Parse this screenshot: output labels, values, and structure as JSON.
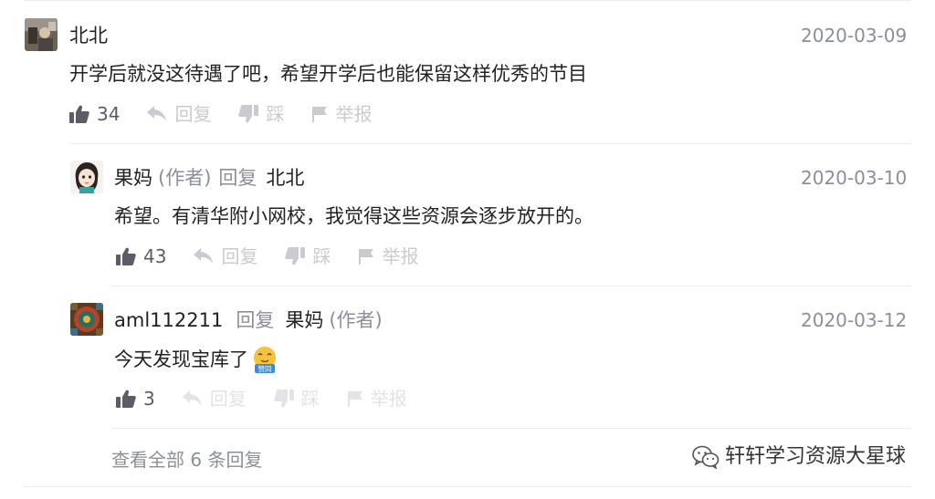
{
  "comments": [
    {
      "author": "北北",
      "date": "2020-03-09",
      "text": "开学后就没这待遇了吧，希望开学后也能保留这样优秀的节目",
      "likes": "34",
      "actions": {
        "reply": "回复",
        "dislike": "踩",
        "report": "举报"
      }
    }
  ],
  "replies": [
    {
      "author": "果妈",
      "author_tag": "(作者)",
      "reply_word": "回复",
      "target": "北北",
      "target_tag": "",
      "date": "2020-03-10",
      "text": "希望。有清华附小网校，我觉得这些资源会逐步放开的。",
      "likes": "43",
      "actions": {
        "reply": "回复",
        "dislike": "踩",
        "report": "举报"
      }
    },
    {
      "author": "aml112211",
      "author_tag": "",
      "reply_word": "回复",
      "target": "果妈",
      "target_tag": "(作者)",
      "date": "2020-03-12",
      "text": "今天发现宝库了",
      "emoji_label": "赞同",
      "likes": "3",
      "actions": {
        "reply": "回复",
        "dislike": "踩",
        "report": "举报"
      }
    }
  ],
  "view_all": "查看全部 6 条回复",
  "watermark": "轩轩学习资源大星球",
  "icons": [
    "thumbs-up-icon",
    "reply-arrow-icon",
    "thumbs-down-icon",
    "flag-icon",
    "wechat-icon",
    "nodding-emoji-icon"
  ],
  "colors": {
    "text": "#222222",
    "muted": "#8c8f99",
    "faded": "#c9cbd1",
    "divider": "#ececec",
    "emoji": "#f5c33b",
    "emoji_badge": "#3a8dde"
  }
}
